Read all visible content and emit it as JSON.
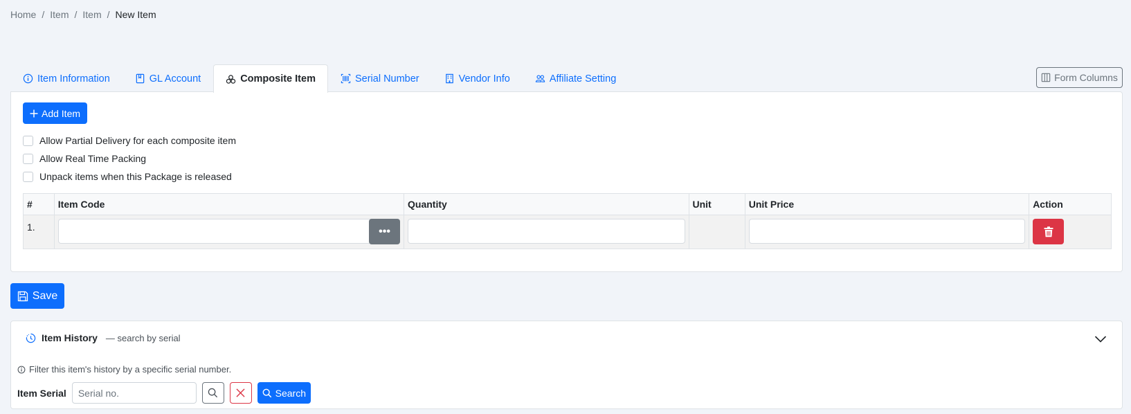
{
  "breadcrumb": [
    "Home",
    "Item",
    "Item",
    "New Item"
  ],
  "tabs": [
    {
      "label": "Item Information",
      "icon": "info-circle-icon"
    },
    {
      "label": "GL Account",
      "icon": "book-icon"
    },
    {
      "label": "Composite Item",
      "icon": "boxes-icon",
      "active": true
    },
    {
      "label": "Serial Number",
      "icon": "barcode-icon"
    },
    {
      "label": "Vendor Info",
      "icon": "building-icon"
    },
    {
      "label": "Affiliate Setting",
      "icon": "people-icon"
    }
  ],
  "form_columns_label": "Form Columns",
  "composite": {
    "add_item_label": "Add Item",
    "options": [
      "Allow Partial Delivery for each composite item",
      "Allow Real Time Packing",
      "Unpack items when this Package is released"
    ],
    "table": {
      "headers": [
        "#",
        "Item Code",
        "Quantity",
        "Unit",
        "Unit Price",
        "Action"
      ],
      "rows": [
        {
          "num": "1."
        }
      ],
      "lookup_button": "•••"
    }
  },
  "save_label": "Save",
  "history": {
    "title": "Item History",
    "subtitle": "— search by serial",
    "info": "Filter this item's history by a specific serial number.",
    "serial_label": "Item Serial",
    "serial_placeholder": "Serial no.",
    "search_label": "Search"
  },
  "colors": {
    "primary": "#0d6efd",
    "danger": "#dc3545",
    "secondary": "#6c757d"
  }
}
